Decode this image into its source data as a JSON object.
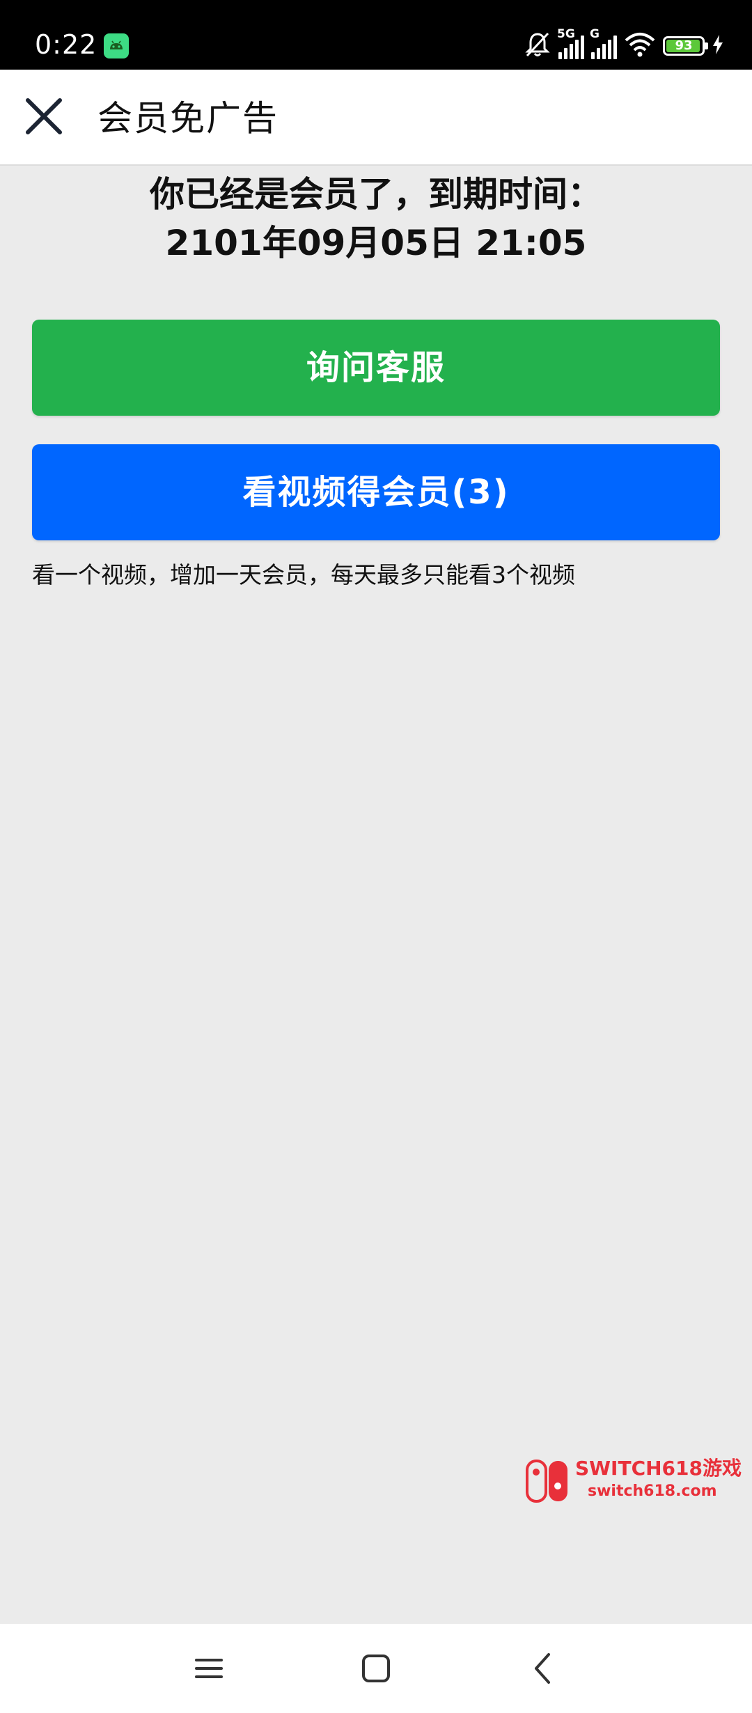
{
  "status_bar": {
    "time": "0:22",
    "network_1": "5G",
    "network_2": "G",
    "battery": "93"
  },
  "app_bar": {
    "title": "会员免广告",
    "close_icon": "close-icon"
  },
  "membership": {
    "status_line1": "你已经是会员了，到期时间：",
    "status_line2": "2101年09月05日 21:05"
  },
  "buttons": {
    "service_label": "询问客服",
    "video_label": "看视频得会员(3)"
  },
  "hint": "看一个视频，增加一天会员，每天最多只能看3个视频",
  "watermark": {
    "line1": "SWITCH618游戏",
    "line2": "switch618.com"
  },
  "colors": {
    "service_button": "#23b14d",
    "video_button": "#0066ff",
    "background": "#ebebeb",
    "watermark": "#e8303a"
  },
  "nav_bar": {
    "icons": [
      "menu-icon",
      "home-icon",
      "back-icon"
    ]
  }
}
